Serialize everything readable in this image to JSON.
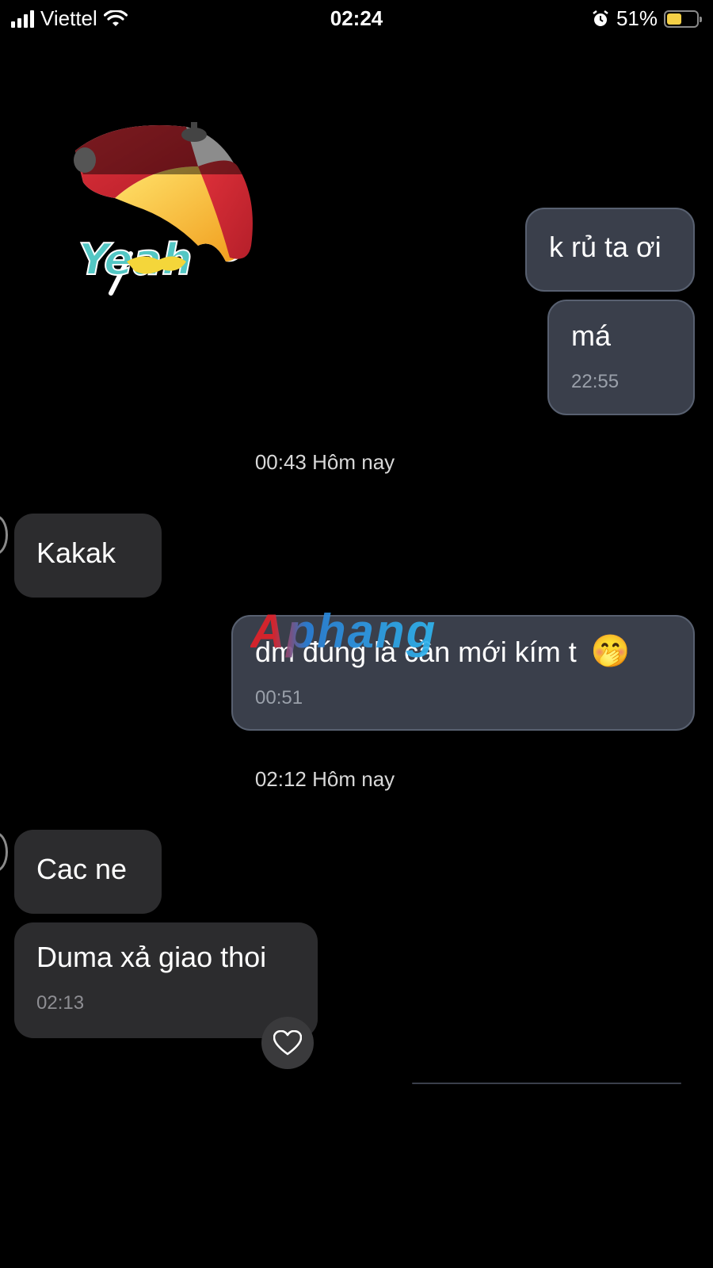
{
  "status_bar": {
    "carrier": "Viettel",
    "time": "02:24",
    "battery": "51%",
    "battery_level": 0.51,
    "icons": [
      "signal-bars-icon",
      "wifi-icon",
      "alarm-icon",
      "battery-icon"
    ]
  },
  "colors": {
    "background": "#000000",
    "outgoing_bubble": "#3a3f4b",
    "incoming_bubble": "#2c2c2e",
    "battery_fill": "#f5d046"
  },
  "sticker": {
    "text": "Yeah"
  },
  "messages_top": [
    {
      "text": "k rủ ta ơi"
    },
    {
      "text": "má",
      "time": "22:55"
    }
  ],
  "separator_1": "00:43 Hôm nay",
  "incoming_1": {
    "text": "Kakak"
  },
  "outgoing_2": {
    "text": "dm đúng là cần mới kím t",
    "emoji": "🤭",
    "time": "00:51"
  },
  "watermark": "Aphang",
  "separator_2": "02:12 Hôm nay",
  "incoming_2": {
    "text": "Cac ne"
  },
  "incoming_3": {
    "text": "Duma xả giao thoi",
    "time": "02:13"
  },
  "reaction_icon": "heart-icon"
}
